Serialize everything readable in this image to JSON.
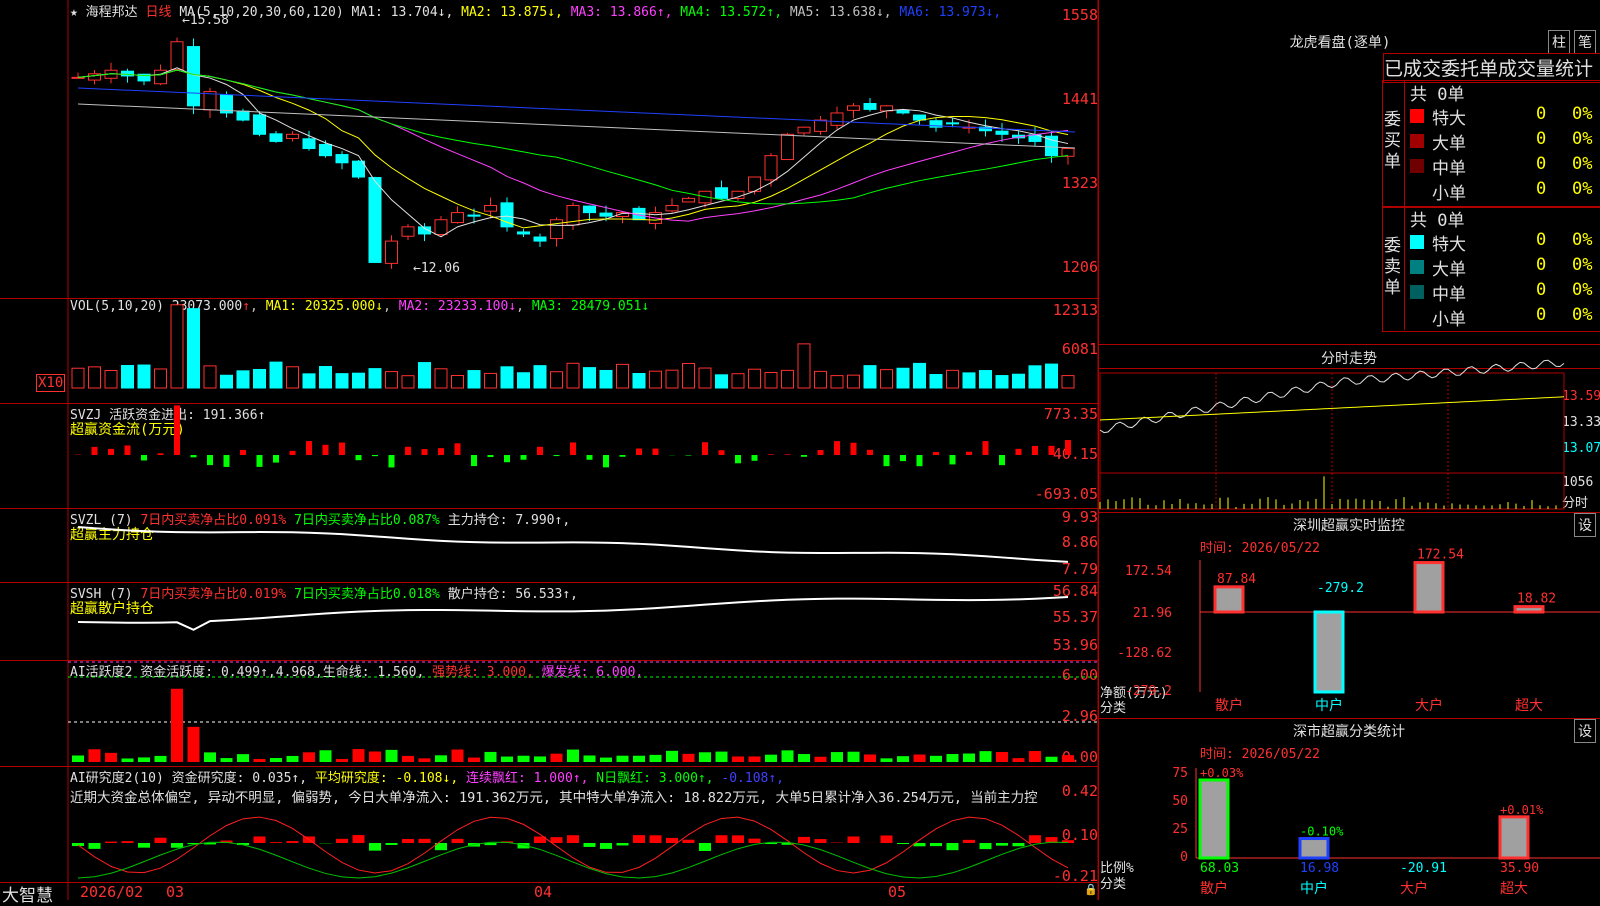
{
  "stock": {
    "star": "★",
    "name": "海程邦达",
    "period": "日线",
    "ma_params": "MA(5,10,20,30,60,120)",
    "ma": [
      {
        "label": "MA1:",
        "value": "13.704",
        "arrow": "↓",
        "color": "#e0e0e0"
      },
      {
        "label": "MA2:",
        "value": "13.875",
        "arrow": "↓",
        "color": "#ffff00"
      },
      {
        "label": "MA3:",
        "value": "13.866",
        "arrow": "↑",
        "color": "#ff40ff"
      },
      {
        "label": "MA4:",
        "value": "13.572",
        "arrow": "↑",
        "color": "#00ff00"
      },
      {
        "label": "MA5:",
        "value": "13.638",
        "arrow": "↓",
        "color": "#c0c0c0"
      },
      {
        "label": "MA6:",
        "value": "13.973",
        "arrow": "↓",
        "color": "#2040ff"
      }
    ],
    "high_label": "15.58",
    "low_label": "12.06"
  },
  "price_axis": [
    "1558",
    "1441",
    "1323",
    "1206"
  ],
  "vol": {
    "header": "VOL(5,10,20)",
    "value": "23073.000",
    "arrow": "↑",
    "ma1": "MA1: 20325.000↓",
    "ma2": "MA2: 23233.100↓",
    "ma3": "MA3: 28479.051↓",
    "axis": [
      "12313",
      "6081"
    ],
    "unit": "X10"
  },
  "svzj": {
    "header": "SVZJ  活跃资金进出: 191.366↑",
    "sub": "超赢资金流(万元)",
    "axis": [
      "773.35",
      "40.15",
      "-693.05"
    ]
  },
  "svzl": {
    "header_a": "SVZL (7)",
    "header_b": "7日内买卖净占比0.091%",
    "header_c": "7日内买卖净占比0.087%",
    "header_d": "主力持仓: 7.990↑,",
    "sub": "超赢主力持仓",
    "axis": [
      "9.93",
      "8.86",
      "7.79"
    ]
  },
  "svsh": {
    "header_a": "SVSH (7)",
    "header_b": "7日内买卖净占比0.019%",
    "header_c": "7日内买卖净占比0.018%",
    "header_d": "散户持仓: 56.533↑,",
    "sub": "超赢散户持仓",
    "axis": [
      "56.84",
      "55.37",
      "53.96"
    ]
  },
  "ai2": {
    "header_a": "AI活跃度2 资金活跃度: 0.499↑,4.968,生命线: 1.560,",
    "header_b": "强势线: 3.000,",
    "header_c": "爆发线: 6.000,",
    "axis": [
      "6.00",
      "2.96",
      "0.00"
    ]
  },
  "ai_research": {
    "header_a": "AI研究度2(10) 资金研究度: 0.035↑,",
    "header_b": "平均研究度: -0.108↓,",
    "header_c": "连续飘红: 1.000↑,",
    "header_d": "N日飘红: 3.000↑,",
    "header_e": "-0.108↑,",
    "text": "近期大资金总体偏空, 异动不明显, 偏弱势, 今日大单净流入: 191.362万元, 其中特大单净流入: 18.822万元, 大单5日累计净入36.254万元, 当前主力控",
    "axis": [
      "0.42",
      "0.10",
      "-0.21"
    ]
  },
  "bottom": {
    "brand": "大智慧",
    "dates": [
      "2026/02",
      "03",
      "04",
      "05"
    ]
  },
  "lhb": {
    "title": "龙虎看盘(逐单)",
    "btn1": "柱",
    "btn2": "笔",
    "heading": "已成交委托单成交量统计",
    "buy": {
      "label": "委买单",
      "total": "共 0单",
      "rows": [
        {
          "name": "特大",
          "v1": "0",
          "v2": "0%",
          "color": "#ff0000"
        },
        {
          "name": "大单",
          "v1": "0",
          "v2": "0%",
          "color": "#a00000"
        },
        {
          "name": "中单",
          "v1": "0",
          "v2": "0%",
          "color": "#700000"
        },
        {
          "name": "小单",
          "v1": "0",
          "v2": "0%",
          "color": ""
        }
      ]
    },
    "sell": {
      "label": "委卖单",
      "total": "共 0单",
      "rows": [
        {
          "name": "特大",
          "v1": "0",
          "v2": "0%",
          "color": "#00ffff"
        },
        {
          "name": "大单",
          "v1": "0",
          "v2": "0%",
          "color": "#008080"
        },
        {
          "name": "中单",
          "v1": "0",
          "v2": "0%",
          "color": "#006060"
        },
        {
          "name": "小单",
          "v1": "0",
          "v2": "0%",
          "color": ""
        }
      ]
    }
  },
  "intraday": {
    "title": "分时走势",
    "axis": [
      "13.59",
      "13.33",
      "13.07"
    ],
    "vol_axis": "1056",
    "vol_unit": "分时"
  },
  "sz_monitor": {
    "title": "深圳超赢实时监控",
    "btn": "设",
    "time": "时间: 2026/05/22",
    "axis": [
      "172.54",
      "21.96",
      "-128.62",
      "-279.2"
    ],
    "ylabel": "净额(万元)",
    "xlabel": "分类",
    "categories": [
      "散户",
      "中户",
      "大户",
      "超大"
    ],
    "values": [
      87.84,
      -279.2,
      172.54,
      18.82
    ],
    "labels": [
      "87.84",
      "-279.2",
      "172.54",
      "18.82"
    ]
  },
  "sz_stats": {
    "title": "深市超赢分类统计",
    "btn": "设",
    "time": "时间: 2026/05/22",
    "axis": [
      "75",
      "50",
      "25",
      "0"
    ],
    "ylabel": "比例%",
    "xlabel": "分类",
    "categories": [
      "散户",
      "中户",
      "大户",
      "超大"
    ],
    "top_labels": [
      "+0.03%",
      "-0.10%",
      "",
      "+0.01%"
    ],
    "bottom_labels": [
      "68.03",
      "16.98",
      "-20.91",
      "35.90"
    ],
    "values": [
      68.03,
      16.98,
      0,
      35.9
    ]
  }
}
